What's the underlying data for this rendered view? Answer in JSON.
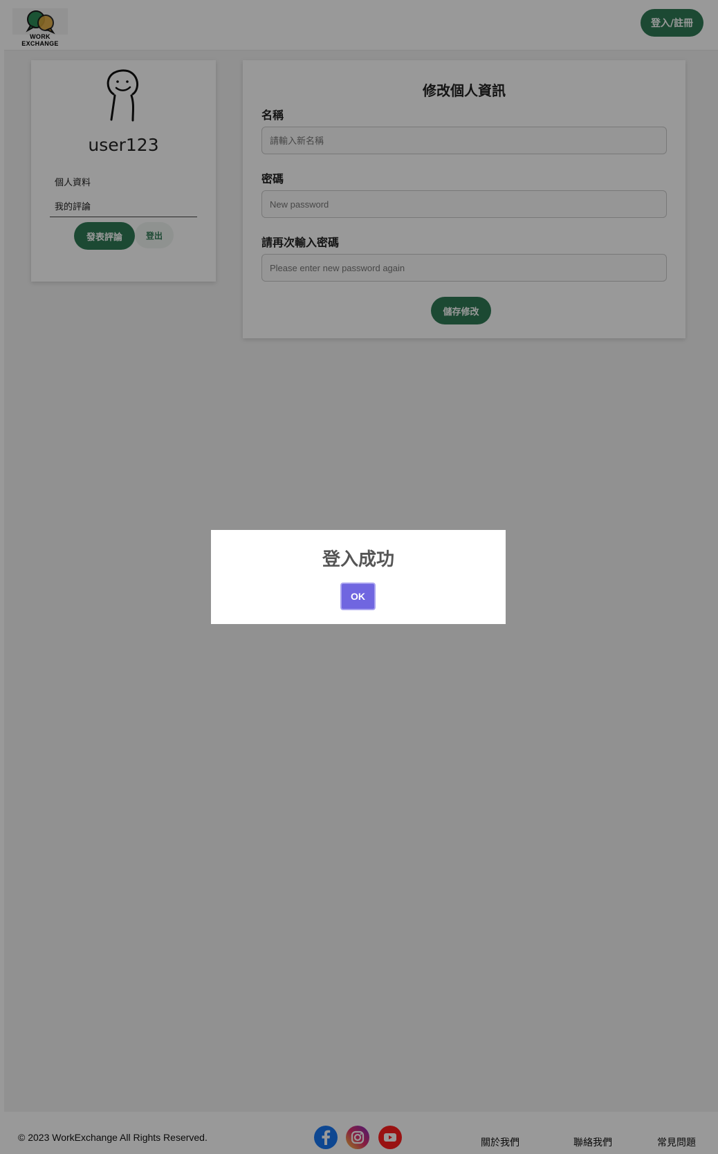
{
  "header": {
    "logo_text": "WORK EXCHANGE",
    "login_label": "登入/註冊"
  },
  "profile": {
    "username": "user123",
    "menu": [
      "個人資料",
      "我的評論"
    ],
    "post_review_label": "發表評論",
    "logout_label": "登出"
  },
  "form": {
    "title": "修改個人資訊",
    "name_label": "名稱",
    "name_placeholder": "請輸入新名稱",
    "password_label": "密碼",
    "password_placeholder": "New password",
    "confirm_label": "請再次輸入密碼",
    "confirm_placeholder": "Please enter new password again",
    "save_label": "儲存修改"
  },
  "footer": {
    "copyright": "© 2023 WorkExchange All Rights Reserved.",
    "social": [
      "facebook-icon",
      "instagram-icon",
      "youtube-icon"
    ],
    "links": [
      "關於我們",
      "聯絡我們",
      "常見問題"
    ]
  },
  "modal": {
    "title": "登入成功",
    "ok_label": "OK"
  },
  "colors": {
    "brand_green": "#2f7a56",
    "modal_button": "#7066e0",
    "overlay": "rgba(0,0,0,0.4)"
  }
}
